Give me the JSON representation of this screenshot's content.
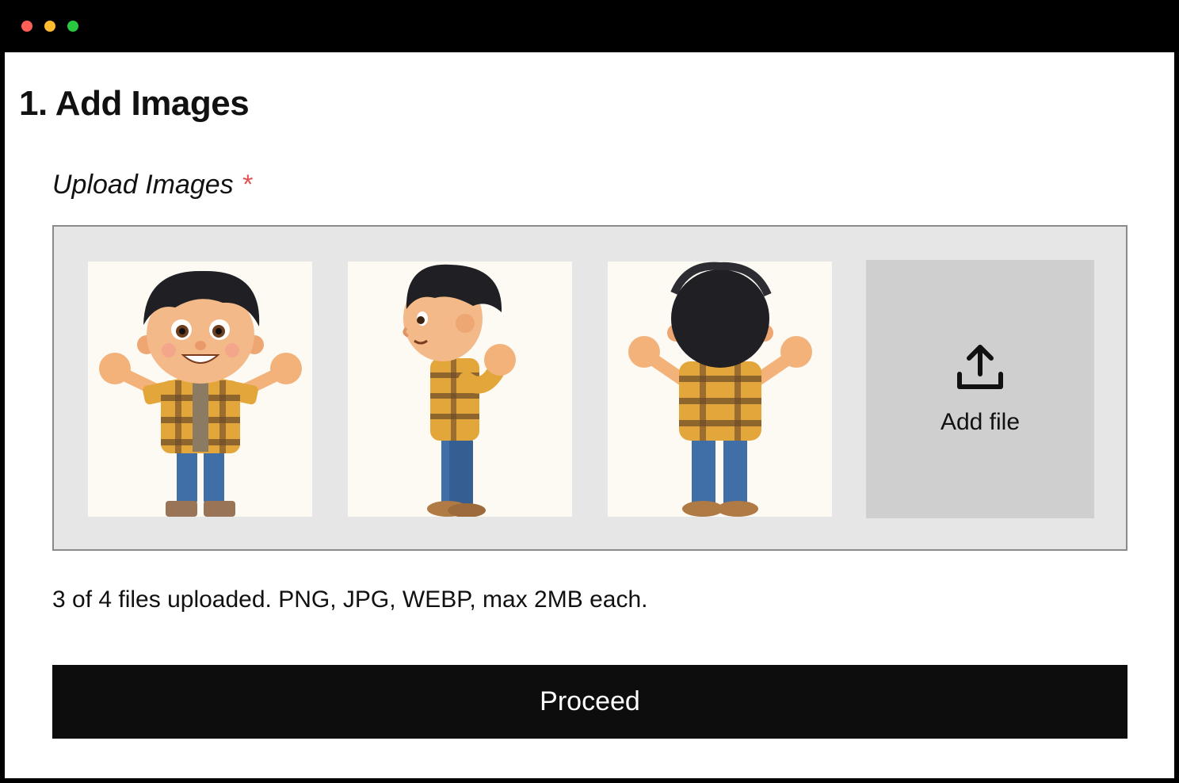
{
  "window": {
    "controls": [
      "close",
      "minimize",
      "zoom"
    ]
  },
  "page": {
    "title": "1. Add Images"
  },
  "upload": {
    "label": "Upload Images",
    "required_marker": "*",
    "add_file_label": "Add file",
    "add_file_icon": "upload-icon",
    "helper_text": "3 of 4 files uploaded. PNG, JPG, WEBP, max 2MB each."
  },
  "actions": {
    "proceed_label": "Proceed"
  },
  "colors": {
    "required": "#e05252",
    "button_bg": "#0d0d0d",
    "dropzone_bg": "#e6e6e6",
    "add_file_bg": "#cfcfcf"
  }
}
